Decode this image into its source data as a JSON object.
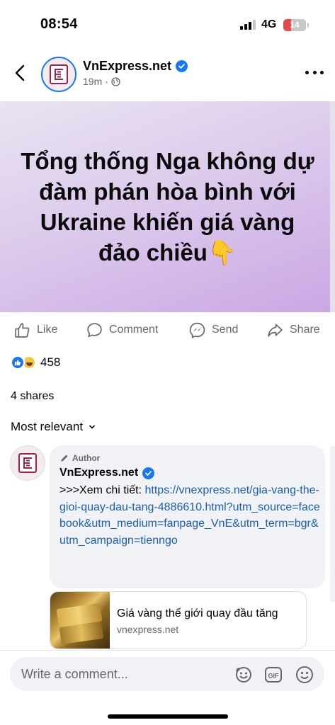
{
  "status_bar": {
    "time": "08:54",
    "network": "4G",
    "battery": "14",
    "battery_level_percent": 14
  },
  "post": {
    "page_name": "VnExpress.net",
    "time": "19m",
    "image_text": "Tổng thống Nga không dự đàm phán hòa bình với Ukraine khiến giá vàng đảo chiều👇",
    "actions": {
      "like": "Like",
      "comment": "Comment",
      "send": "Send",
      "share": "Share"
    },
    "reaction_count": "458",
    "shares": "4 shares",
    "sort_label": "Most relevant"
  },
  "comment": {
    "author_tag": "Author",
    "name": "VnExpress.net",
    "prefix": ">>>Xem chi tiết: ",
    "link": "https://vnexpress.net/gia-vang-the-gioi-quay-dau-tang-4886610.html?utm_source=facebook&utm_medium=fanpage_VnE&utm_term=bgr&utm_campaign=tienngo"
  },
  "link_card": {
    "title": "Giá vàng thế giới quay đầu tăng",
    "domain": "vnexpress.net"
  },
  "composer": {
    "placeholder": "Write a comment..."
  },
  "icons": [
    "back-icon",
    "verified-icon",
    "globe-icon",
    "more-icon",
    "like-icon",
    "comment-icon",
    "send-icon",
    "share-icon",
    "chevron-down-icon",
    "pencil-icon",
    "avatar-sticker-icon",
    "gif-icon",
    "emoji-icon"
  ],
  "colors": {
    "facebook_blue": "#1877f2",
    "link_blue": "#1a5fb4",
    "vnexpress_brand": "#9f224e",
    "battery_low": "#e5484d"
  }
}
